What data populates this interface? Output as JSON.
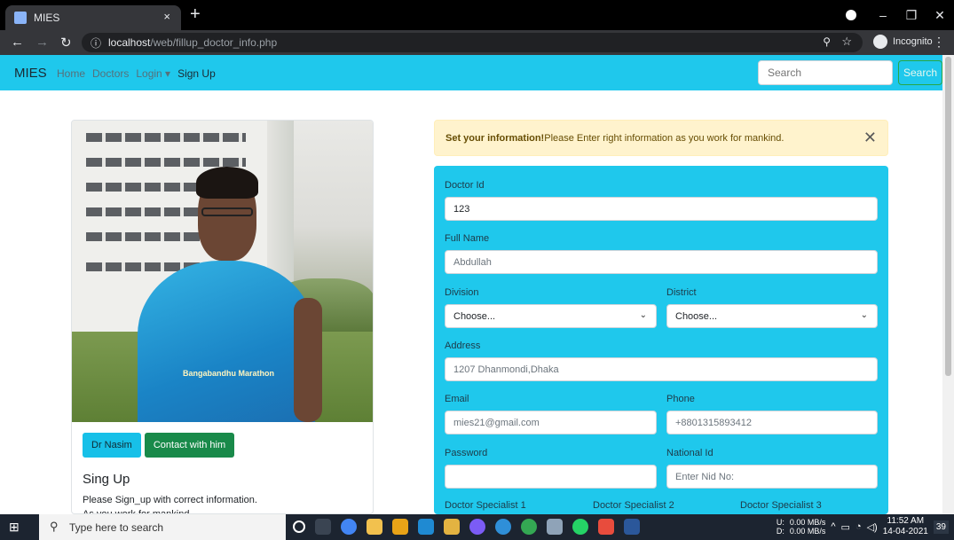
{
  "browser": {
    "tab_title": "MIES",
    "tab_close": "×",
    "new_tab": "+",
    "url_host": "localhost",
    "url_path": "/web/fillup_doctor_info.php",
    "incognito_label": "Incognito"
  },
  "navbar": {
    "brand": "MIES",
    "links": [
      {
        "label": "Home"
      },
      {
        "label": "Doctors"
      },
      {
        "label": "Login ▾"
      },
      {
        "label": "Sign Up"
      }
    ],
    "search_placeholder": "Search",
    "search_button": "Search"
  },
  "profile_card": {
    "shirt_text": "Bangabandhu Marathon",
    "name_button": "Dr Nasim",
    "contact_button": "Contact with him",
    "title": "Sing Up",
    "text_line1": "Please Sign_up with correct information.",
    "text_line2": "As you work for mankind ."
  },
  "alert": {
    "strong": "Set your information!",
    "message": "Please Enter right information as you work for mankind.",
    "close": "✕"
  },
  "form": {
    "doctor_id_label": "Doctor Id",
    "doctor_id_value": "123",
    "full_name_label": "Full Name",
    "full_name_placeholder": "Abdullah",
    "division_label": "Division",
    "division_value": "Choose...",
    "district_label": "District",
    "district_value": "Choose...",
    "address_label": "Address",
    "address_placeholder": "1207 Dhanmondi,Dhaka",
    "email_label": "Email",
    "email_placeholder": "mies21@gmail.com",
    "phone_label": "Phone",
    "phone_placeholder": "+8801315893412",
    "password_label": "Password",
    "password_value": "",
    "national_id_label": "National Id",
    "national_id_placeholder": "Enter Nid No:",
    "specialist1_label": "Doctor Specialist 1",
    "specialist2_label": "Doctor Specialist 2",
    "specialist3_label": "Doctor Specialist 3"
  },
  "taskbar": {
    "search_placeholder": "Type here to search",
    "net_up": "0.00 MB/s",
    "net_down": "0.00 MB/s",
    "drive_u": "U:",
    "drive_d": "D:",
    "time": "11:52 AM",
    "date": "14-04-2021",
    "notif_count": "39"
  },
  "colors": {
    "navbar": "#1fc8ec",
    "alert_bg": "#fff3cd",
    "success": "#198a4a"
  }
}
